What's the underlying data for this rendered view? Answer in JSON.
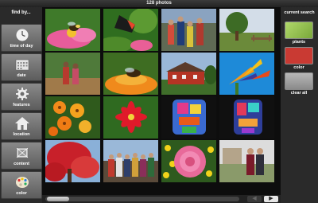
{
  "app": {
    "title": "128 photos"
  },
  "left": {
    "header": "find by...",
    "buttons": [
      {
        "label": "time of day",
        "icon": "clock-icon"
      },
      {
        "label": "date",
        "icon": "calendar-icon"
      },
      {
        "label": "features",
        "icon": "gear-icon"
      },
      {
        "label": "location",
        "icon": "house-icon"
      },
      {
        "label": "content",
        "icon": "content-icon"
      },
      {
        "label": "color",
        "icon": "palette-icon"
      }
    ]
  },
  "right": {
    "header": "current search",
    "chips": [
      {
        "label": "plants",
        "color": "#8fc24a"
      },
      {
        "label": "color",
        "color": "#c93a33"
      },
      {
        "label": "clear all",
        "color": "#9a9a9a"
      }
    ]
  },
  "photos": [
    "photo-bee-flower",
    "photo-butterfly",
    "photo-people-crowd",
    "photo-tree-landscape",
    "photo-family-portrait",
    "photo-people-field",
    "photo-bee-flower-2",
    "photo-red-house",
    "photo-bird-of-paradise",
    "photo-orange-flowers",
    "photo-red-flower",
    "photo-colorful-figure",
    "photo-colorful-figure-2",
    "photo-red-tree",
    "photo-group-people",
    "photo-yellow-flowers-pink-rose",
    "photo-couple-portrait"
  ],
  "nav": {
    "prev_label": "◀",
    "next_label": "▶"
  }
}
